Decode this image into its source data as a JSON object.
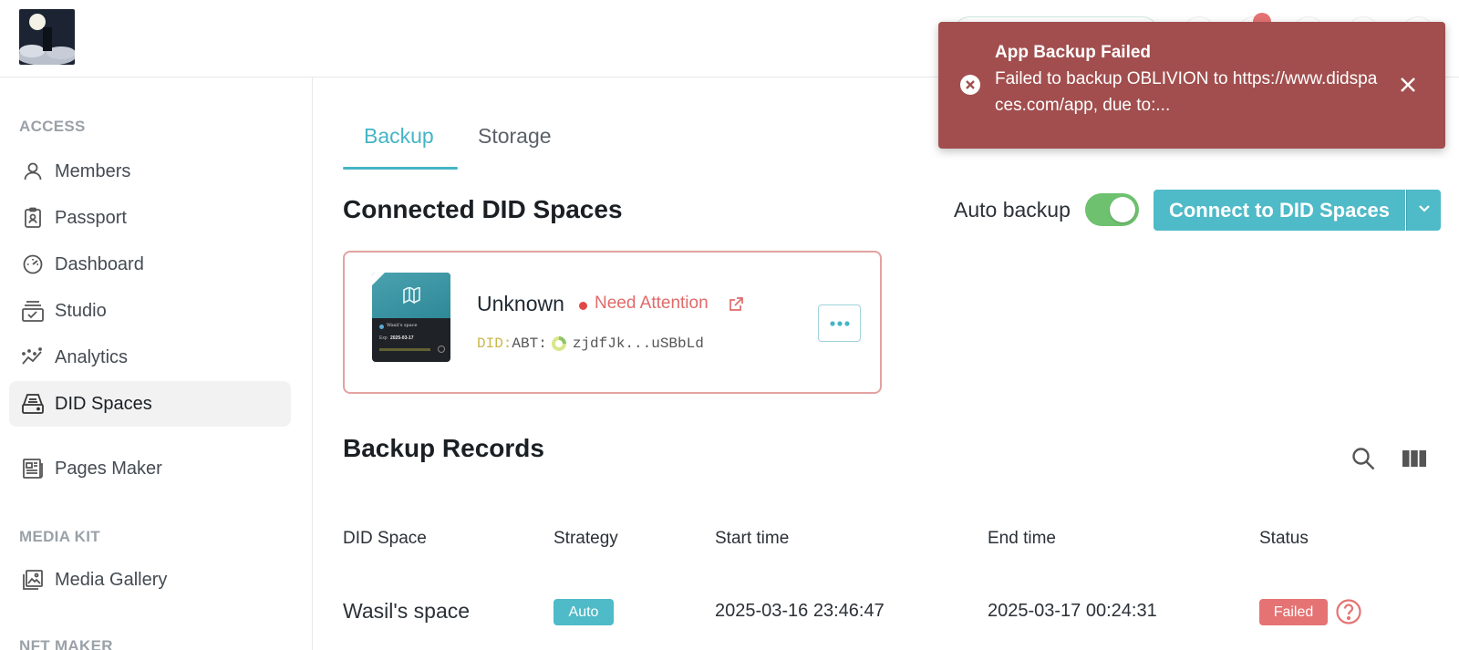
{
  "sidebar": {
    "sections": [
      "ACCESS",
      "MEDIA KIT",
      "NFT MAKER"
    ],
    "items": [
      {
        "label": "Members",
        "icon": "person-icon"
      },
      {
        "label": "Passport",
        "icon": "badge-icon"
      },
      {
        "label": "Dashboard",
        "icon": "gauge-icon"
      },
      {
        "label": "Studio",
        "icon": "studio-icon"
      },
      {
        "label": "Analytics",
        "icon": "analytics-icon"
      },
      {
        "label": "DID Spaces",
        "icon": "drive-icon",
        "active": true
      },
      {
        "label": "Pages Maker",
        "icon": "newspaper-icon"
      },
      {
        "label": "Media Gallery",
        "icon": "gallery-icon"
      }
    ]
  },
  "tabs": [
    {
      "label": "Backup",
      "active": true
    },
    {
      "label": "Storage",
      "active": false
    }
  ],
  "connected": {
    "title": "Connected DID Spaces",
    "auto_backup_label": "Auto backup",
    "auto_backup_on": true,
    "connect_label": "Connect to DID Spaces"
  },
  "did_card": {
    "name": "Unknown",
    "status": "Need Attention",
    "did_prefix": "DID:",
    "did_type": "ABT:",
    "did_address": "zjdfJk...uSBbLd",
    "thumb_space_name": "Wasil's space",
    "thumb_exp": "2025-03-17"
  },
  "records": {
    "title": "Backup Records",
    "columns": [
      "DID Space",
      "Strategy",
      "Start time",
      "End time",
      "Status"
    ],
    "rows": [
      {
        "space": "Wasil's space",
        "strategy": "Auto",
        "start": "2025-03-16 23:46:47",
        "end": "2025-03-17 00:24:31",
        "status": "Failed"
      }
    ]
  },
  "toast": {
    "title": "App Backup Failed",
    "message": "Failed to backup OBLIVION to https://www.didspaces.com/app, due to:..."
  },
  "colors": {
    "accent": "#45b5c4",
    "toggle_on": "#6ec16e",
    "error": "#e57373",
    "toast_bg": "#a24e4e"
  }
}
